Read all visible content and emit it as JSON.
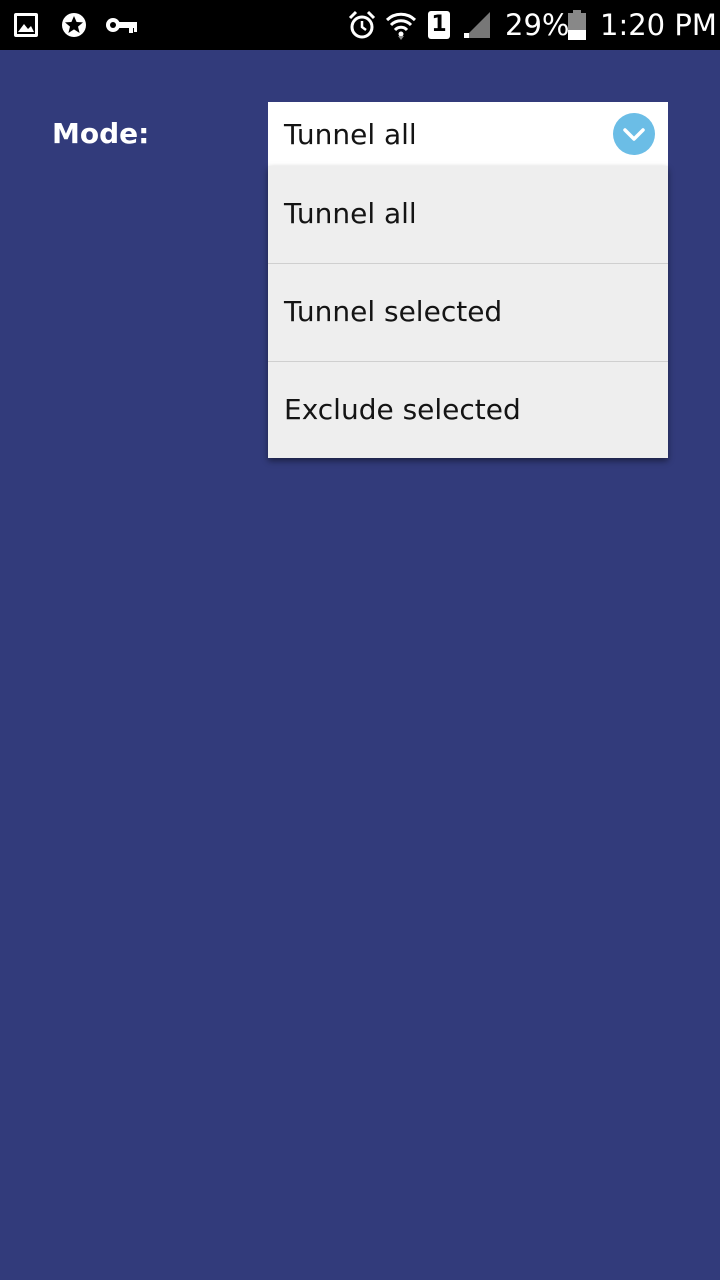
{
  "status_bar": {
    "icons_left": [
      "gallery-icon",
      "star-badge-icon",
      "key-icon"
    ],
    "icons_right": [
      "alarm-icon",
      "wifi-icon",
      "sim-1-icon",
      "signal-icon",
      "battery-icon"
    ],
    "sim_label": "1",
    "battery_percent": "29%",
    "time": "1:20 PM"
  },
  "colors": {
    "background": "#323b7b",
    "status_bar": "#000000",
    "spinner_bg": "#ffffff",
    "dropdown_bg": "#eeeeee",
    "accent": "#6bbde6"
  },
  "form": {
    "mode_label": "Mode:",
    "mode_selected": "Tunnel all",
    "mode_options": [
      "Tunnel all",
      "Tunnel selected",
      "Exclude selected"
    ]
  }
}
